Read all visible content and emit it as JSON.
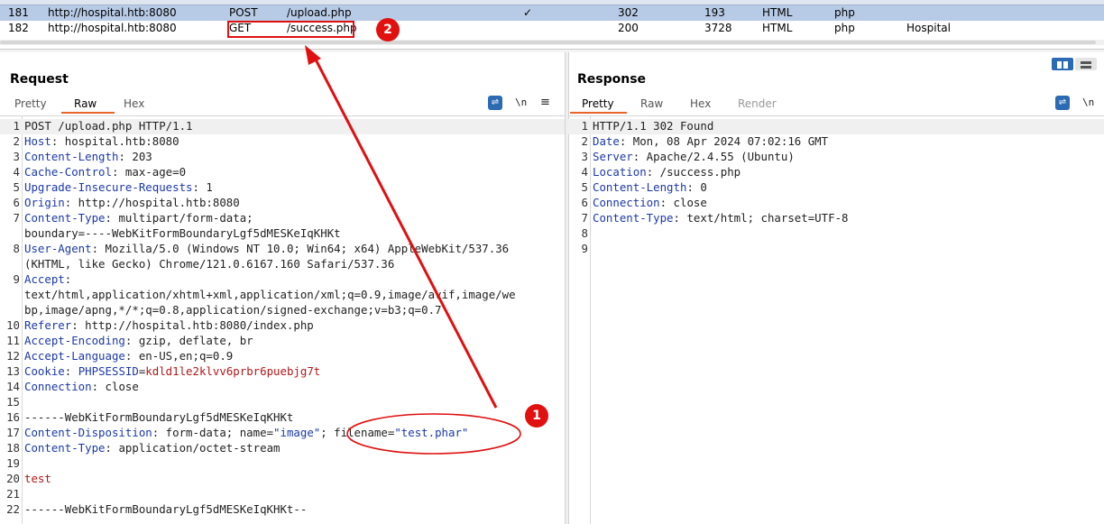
{
  "history": {
    "rows": [
      {
        "num": "181",
        "host": "http://hospital.htb:8080",
        "method": "POST",
        "url": "/upload.php",
        "edited": "✓",
        "status": "302",
        "length": "193",
        "mime": "HTML",
        "ext": "php",
        "title": ""
      },
      {
        "num": "182",
        "host": "http://hospital.htb:8080",
        "method": "GET",
        "url": "/success.php",
        "edited": "",
        "status": "200",
        "length": "3728",
        "mime": "HTML",
        "ext": "php",
        "title": "Hospital"
      }
    ]
  },
  "request": {
    "title": "Request",
    "tabs": [
      "Pretty",
      "Raw",
      "Hex"
    ],
    "active_tab": "Raw",
    "lines": [
      {
        "n": "1",
        "parts": [
          [
            "v",
            "POST /upload.php HTTP/1.1"
          ]
        ]
      },
      {
        "n": "2",
        "parts": [
          [
            "k",
            "Host"
          ],
          [
            "v",
            ": hospital.htb:8080"
          ]
        ]
      },
      {
        "n": "3",
        "parts": [
          [
            "k",
            "Content-Length"
          ],
          [
            "v",
            ": 203"
          ]
        ]
      },
      {
        "n": "4",
        "parts": [
          [
            "k",
            "Cache-Control"
          ],
          [
            "v",
            ": max-age=0"
          ]
        ]
      },
      {
        "n": "5",
        "parts": [
          [
            "k",
            "Upgrade-Insecure-Requests"
          ],
          [
            "v",
            ": 1"
          ]
        ]
      },
      {
        "n": "6",
        "parts": [
          [
            "k",
            "Origin"
          ],
          [
            "v",
            ": http://hospital.htb:8080"
          ]
        ]
      },
      {
        "n": "7",
        "parts": [
          [
            "k",
            "Content-Type"
          ],
          [
            "v",
            ": multipart/form-data;"
          ]
        ]
      },
      {
        "n": "",
        "parts": [
          [
            "v",
            "boundary=----WebKitFormBoundaryLgf5dMESKeIqKHKt"
          ]
        ]
      },
      {
        "n": "8",
        "parts": [
          [
            "k",
            "User-Agent"
          ],
          [
            "v",
            ": Mozilla/5.0 (Windows NT 10.0; Win64; x64) AppleWebKit/537.36"
          ]
        ]
      },
      {
        "n": "",
        "parts": [
          [
            "v",
            "(KHTML, like Gecko) Chrome/121.0.6167.160 Safari/537.36"
          ]
        ]
      },
      {
        "n": "9",
        "parts": [
          [
            "k",
            "Accept"
          ],
          [
            "v",
            ":"
          ]
        ]
      },
      {
        "n": "",
        "parts": [
          [
            "v",
            "text/html,application/xhtml+xml,application/xml;q=0.9,image/avif,image/we"
          ]
        ]
      },
      {
        "n": "",
        "parts": [
          [
            "v",
            "bp,image/apng,*/*;q=0.8,application/signed-exchange;v=b3;q=0.7"
          ]
        ]
      },
      {
        "n": "10",
        "parts": [
          [
            "k",
            "Referer"
          ],
          [
            "v",
            ": http://hospital.htb:8080/index.php"
          ]
        ]
      },
      {
        "n": "11",
        "parts": [
          [
            "k",
            "Accept-Encoding"
          ],
          [
            "v",
            ": gzip, deflate, br"
          ]
        ]
      },
      {
        "n": "12",
        "parts": [
          [
            "k",
            "Accept-Language"
          ],
          [
            "v",
            ": en-US,en;q=0.9"
          ]
        ]
      },
      {
        "n": "13",
        "parts": [
          [
            "k",
            "Cookie"
          ],
          [
            "v",
            ": "
          ],
          [
            "s",
            "PHPSESSID"
          ],
          [
            "v",
            "="
          ],
          [
            "r",
            "kdld1le2klvv6prbr6puebjg7t"
          ]
        ]
      },
      {
        "n": "14",
        "parts": [
          [
            "k",
            "Connection"
          ],
          [
            "v",
            ": close"
          ]
        ]
      },
      {
        "n": "15",
        "parts": []
      },
      {
        "n": "16",
        "parts": [
          [
            "v",
            "------WebKitFormBoundaryLgf5dMESKeIqKHKt"
          ]
        ]
      },
      {
        "n": "17",
        "parts": [
          [
            "k",
            "Content-Disposition"
          ],
          [
            "v",
            ": form-data; name="
          ],
          [
            "s",
            "\"image\""
          ],
          [
            "v",
            "; filename="
          ],
          [
            "s",
            "\"test.phar\""
          ]
        ]
      },
      {
        "n": "18",
        "parts": [
          [
            "k",
            "Content-Type"
          ],
          [
            "v",
            ": application/octet-stream"
          ]
        ]
      },
      {
        "n": "19",
        "parts": []
      },
      {
        "n": "20",
        "parts": [
          [
            "r",
            "test"
          ]
        ]
      },
      {
        "n": "21",
        "parts": []
      },
      {
        "n": "22",
        "parts": [
          [
            "v",
            "------WebKitFormBoundaryLgf5dMESKeIqKHKt--"
          ]
        ]
      }
    ]
  },
  "response": {
    "title": "Response",
    "tabs": [
      "Pretty",
      "Raw",
      "Hex",
      "Render"
    ],
    "active_tab": "Pretty",
    "lines": [
      {
        "n": "1",
        "parts": [
          [
            "v",
            "HTTP/1.1 302 Found"
          ]
        ]
      },
      {
        "n": "2",
        "parts": [
          [
            "k",
            "Date"
          ],
          [
            "v",
            ": Mon, 08 Apr 2024 07:02:16 GMT"
          ]
        ]
      },
      {
        "n": "3",
        "parts": [
          [
            "k",
            "Server"
          ],
          [
            "v",
            ": Apache/2.4.55 (Ubuntu)"
          ]
        ]
      },
      {
        "n": "4",
        "parts": [
          [
            "k",
            "Location"
          ],
          [
            "v",
            ": /success.php"
          ]
        ]
      },
      {
        "n": "5",
        "parts": [
          [
            "k",
            "Content-Length"
          ],
          [
            "v",
            ": 0"
          ]
        ]
      },
      {
        "n": "6",
        "parts": [
          [
            "k",
            "Connection"
          ],
          [
            "v",
            ": close"
          ]
        ]
      },
      {
        "n": "7",
        "parts": [
          [
            "k",
            "Content-Type"
          ],
          [
            "v",
            ": text/html; charset=UTF-8"
          ]
        ]
      },
      {
        "n": "8",
        "parts": []
      },
      {
        "n": "9",
        "parts": []
      }
    ]
  },
  "tools": {
    "wrap_icon": "wrap-lines-icon",
    "newline_label": "\\n",
    "menu_icon": "hamburger-menu-icon"
  },
  "annotations": {
    "badge1": "1",
    "badge2": "2"
  },
  "colors": {
    "accent": "#e8642c",
    "annotation_red": "#e01010",
    "header_key": "#1b39a8",
    "cookie_value": "#b21818"
  }
}
